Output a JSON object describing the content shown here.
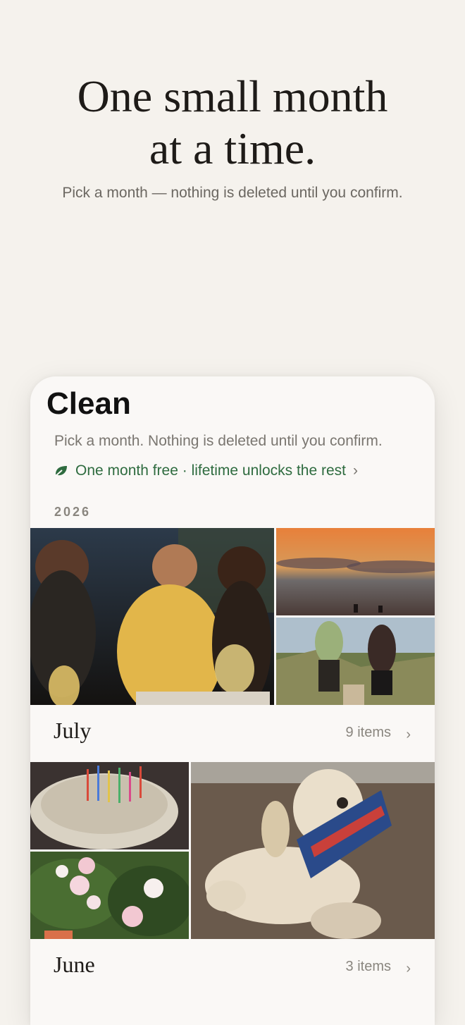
{
  "hero": {
    "title_line1": "One small month",
    "title_line2": "at a time.",
    "subtitle": "Pick a month — nothing is deleted until you confirm."
  },
  "app": {
    "title": "Clean",
    "subtitle": "Pick a month. Nothing is deleted until you confirm.",
    "promo_text": "One month free · lifetime unlocks the rest",
    "promo_icon": "leaf-icon",
    "accent_color": "#2e6b3f",
    "year_label": "2026",
    "months": [
      {
        "name": "July",
        "count": "9 items"
      },
      {
        "name": "June",
        "count": "3 items"
      }
    ]
  }
}
